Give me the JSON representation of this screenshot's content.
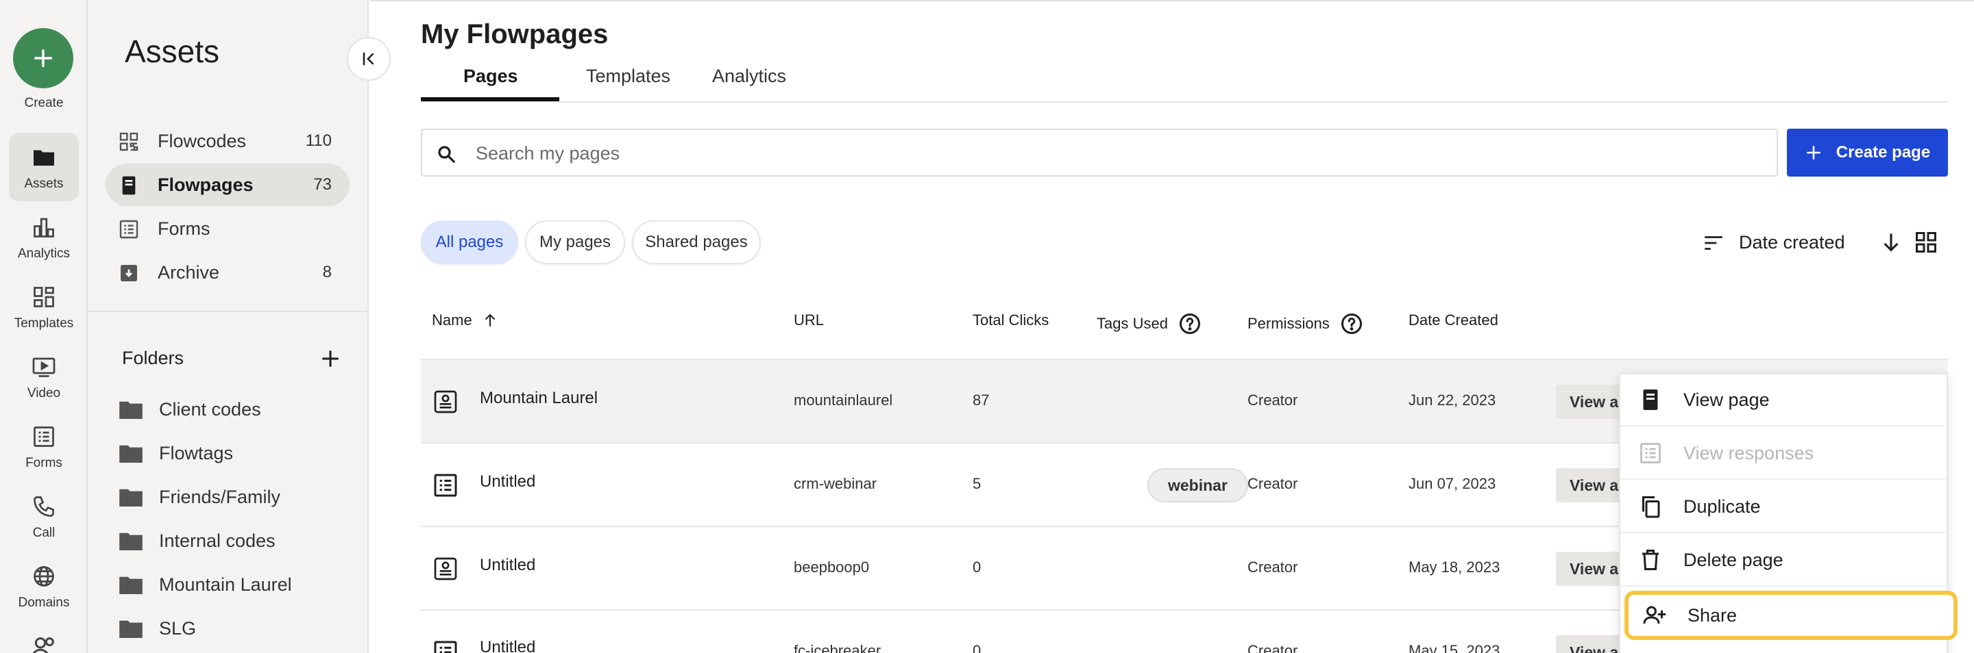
{
  "rail": {
    "create_label": "Create",
    "items": [
      {
        "label": "Assets",
        "icon": "folder-icon",
        "active": true
      },
      {
        "label": "Analytics",
        "icon": "bar-chart-icon"
      },
      {
        "label": "Templates",
        "icon": "templates-grid-icon"
      },
      {
        "label": "Video",
        "icon": "video-play-icon"
      },
      {
        "label": "Forms",
        "icon": "form-list-icon"
      },
      {
        "label": "Call",
        "icon": "phone-icon"
      },
      {
        "label": "Domains",
        "icon": "globe-icon"
      }
    ]
  },
  "panel": {
    "title": "Assets",
    "nav": [
      {
        "label": "Flowcodes",
        "count": "110",
        "icon": "qr-code-icon"
      },
      {
        "label": "Flowpages",
        "count": "73",
        "icon": "mobile-page-icon",
        "active": true
      },
      {
        "label": "Forms",
        "count": "",
        "icon": "form-list-icon"
      },
      {
        "label": "Archive",
        "count": "8",
        "icon": "archive-box-icon"
      }
    ],
    "folders_heading": "Folders",
    "folders": [
      "Client codes",
      "Flowtags",
      "Friends/Family",
      "Internal codes",
      "Mountain Laurel",
      "SLG"
    ]
  },
  "main": {
    "title": "My Flowpages",
    "tabs": [
      "Pages",
      "Templates",
      "Analytics"
    ],
    "active_tab": "Pages",
    "search_placeholder": "Search my pages",
    "create_button": "Create page",
    "filters": [
      "All pages",
      "My pages",
      "Shared pages"
    ],
    "active_filter": "All pages",
    "sort_label": "Date created"
  },
  "table": {
    "headers": [
      "Name",
      "URL",
      "Total Clicks",
      "Tags Used",
      "Permissions",
      "Date Created"
    ],
    "rows": [
      {
        "name": "Mountain Laurel",
        "url": "mountainlaurel",
        "clicks": "87",
        "tag": "",
        "permission": "Creator",
        "date": "Jun 22, 2023",
        "action": "View a"
      },
      {
        "name": "Untitled",
        "url": "crm-webinar",
        "clicks": "5",
        "tag": "webinar",
        "permission": "Creator",
        "date": "Jun 07, 2023",
        "action": "View a"
      },
      {
        "name": "Untitled",
        "url": "beepboop0",
        "clicks": "0",
        "tag": "",
        "permission": "Creator",
        "date": "May 18, 2023",
        "action": "View a"
      },
      {
        "name": "Untitled",
        "url": "fc-icebreaker",
        "clicks": "0",
        "tag": "",
        "permission": "Creator",
        "date": "May 15, 2023",
        "action": "View a"
      }
    ]
  },
  "menu": {
    "items": [
      {
        "label": "View page",
        "icon": "mobile-page-icon"
      },
      {
        "label": "View responses",
        "icon": "form-list-icon",
        "disabled": true
      },
      {
        "label": "Duplicate",
        "icon": "copy-icon"
      },
      {
        "label": "Delete page",
        "icon": "trash-icon"
      },
      {
        "label": "Share",
        "icon": "add-person-icon",
        "focused": true
      }
    ]
  },
  "colors": {
    "brand_green": "#3e8a55",
    "primary_blue": "#1e47d6",
    "focus_ring": "#f5c542",
    "sidebar_bg": "#f4f3f1"
  }
}
